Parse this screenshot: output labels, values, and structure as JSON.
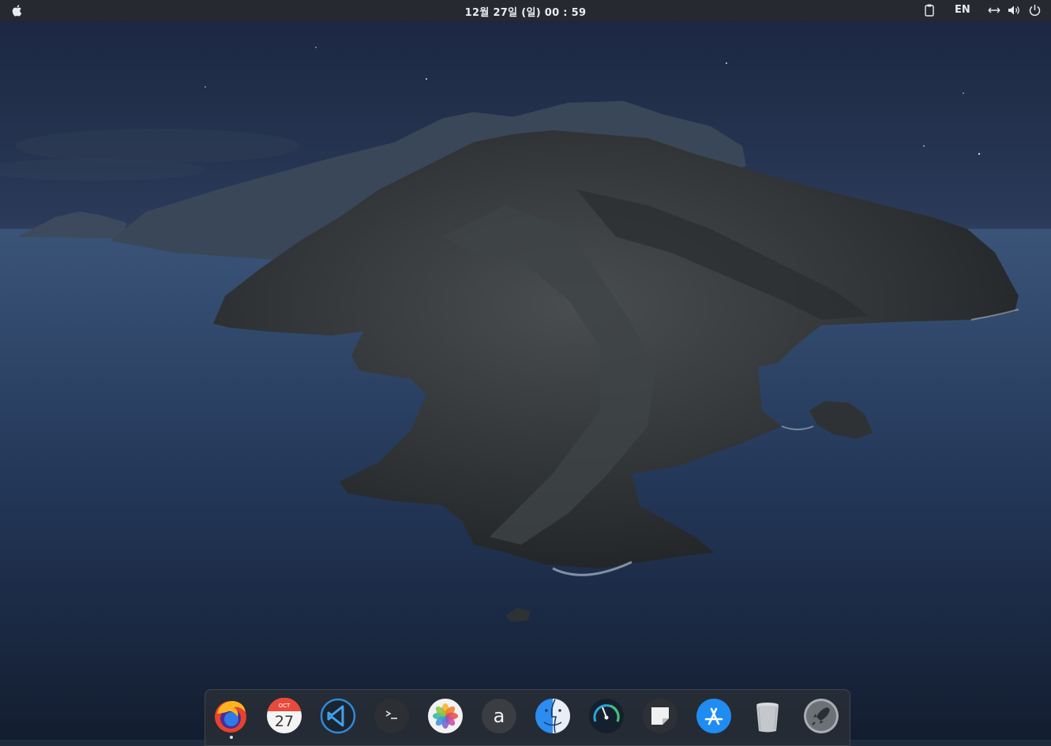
{
  "topbar": {
    "clock": "12월 27일 (일) 00 : 59",
    "language": "EN",
    "icons": [
      "apple-logo-icon",
      "clipboard-icon",
      "network-icon",
      "volume-icon",
      "power-icon"
    ]
  },
  "dock": {
    "items": [
      {
        "name": "Firefox",
        "icon": "firefox-icon",
        "running": true
      },
      {
        "name": "Calendar",
        "icon": "calendar-icon",
        "month": "OCT",
        "day": "27"
      },
      {
        "name": "Visual Studio Code",
        "icon": "vscode-icon"
      },
      {
        "name": "Terminal",
        "icon": "terminal-icon",
        "glyph": ">_"
      },
      {
        "name": "Photos",
        "icon": "photos-icon"
      },
      {
        "name": "Font Manager",
        "icon": "font-icon",
        "glyph": "a"
      },
      {
        "name": "Finder",
        "icon": "finder-icon"
      },
      {
        "name": "System Monitor",
        "icon": "gauge-icon"
      },
      {
        "name": "Notes",
        "icon": "sticker-icon"
      },
      {
        "name": "App Store",
        "icon": "app-store-icon"
      },
      {
        "name": "Trash",
        "icon": "trash-icon"
      },
      {
        "name": "Launchpad",
        "icon": "rocket-icon"
      }
    ]
  },
  "colors": {
    "topbar": "#262a30",
    "sky": "#22304a",
    "sea": "#25395a",
    "island": "#2d3134"
  }
}
